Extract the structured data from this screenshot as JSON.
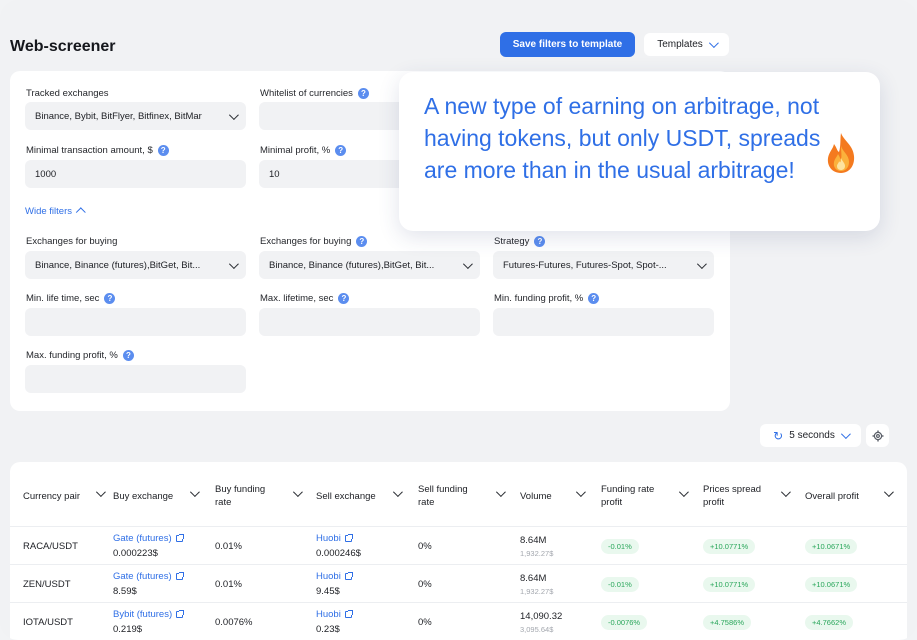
{
  "app": {
    "title": "Web-screener",
    "save_filters_label": "Save filters to template",
    "templates_label": "Templates"
  },
  "filters": {
    "tracked_exchanges": {
      "label": "Tracked exchanges",
      "value": "Binance, Bybit, BitFlyer, Bitfinex, BitMar"
    },
    "whitelist": {
      "label": "Whitelist of currencies",
      "value": ""
    },
    "min_transaction": {
      "label": "Minimal transaction amount, $",
      "value": "1000"
    },
    "min_profit": {
      "label": "Minimal profit, %",
      "value": "10"
    },
    "wide_filters_label": "Wide filters",
    "exchanges_buying_1": {
      "label": "Exchanges for buying",
      "value": "Binance, Binance (futures),BitGet, Bit..."
    },
    "exchanges_buying_2": {
      "label": "Exchanges for buying",
      "value": "Binance, Binance (futures),BitGet, Bit..."
    },
    "strategy": {
      "label": "Strategy",
      "value": "Futures-Futures, Futures-Spot, Spot-..."
    },
    "min_lifetime": {
      "label": "Min. life time, sec",
      "value": ""
    },
    "max_lifetime": {
      "label": "Max. lifetime, sec",
      "value": ""
    },
    "min_funding": {
      "label": "Min. funding profit, %",
      "value": ""
    },
    "max_funding": {
      "label": "Max. funding profit, %",
      "value": ""
    }
  },
  "tooltip": {
    "text": "A new type of earning on arbitrage, not having tokens, but only USDT, spreads are more than in the usual arbitrage!",
    "icon": "fire-icon"
  },
  "refresh": {
    "label": "5 seconds",
    "icon": "refresh-icon"
  },
  "table": {
    "headers": [
      "Currency pair",
      "Buy exchange",
      "Buy funding rate",
      "Sell exchange",
      "Sell funding rate",
      "Volume",
      "Funding rate profit",
      "Prices spread profit",
      "Overall profit"
    ],
    "rows": [
      {
        "pair": "RACA/USDT",
        "buy_exchange": "Gate (futures)",
        "buy_price": "0.000223$",
        "buy_funding": "0.01%",
        "sell_exchange": "Huobi",
        "sell_price": "0.000246$",
        "sell_funding": "0%",
        "volume": "8.64M",
        "volume_sub": "1,932.27$",
        "funding_profit": "-0.01%",
        "spread_profit": "+10.0771%",
        "overall_profit": "+10.0671%"
      },
      {
        "pair": "ZEN/USDT",
        "buy_exchange": "Gate (futures)",
        "buy_price": "8.59$",
        "buy_funding": "0.01%",
        "sell_exchange": "Huobi",
        "sell_price": "9.45$",
        "sell_funding": "0%",
        "volume": "8.64M",
        "volume_sub": "1,932.27$",
        "funding_profit": "-0.01%",
        "spread_profit": "+10.0771%",
        "overall_profit": "+10.0671%"
      },
      {
        "pair": "IOTA/USDT",
        "buy_exchange": "Bybit (futures)",
        "buy_price": "0.219$",
        "buy_funding": "0.0076%",
        "sell_exchange": "Huobi",
        "sell_price": "0.23$",
        "sell_funding": "0%",
        "volume": "14,090.32",
        "volume_sub": "3,095.64$",
        "funding_profit": "-0.0076%",
        "spread_profit": "+4.7586%",
        "overall_profit": "+4.7662%"
      }
    ]
  },
  "colors": {
    "accent": "#2f6fe6",
    "positive_bg": "#e9f8ee",
    "positive_text": "#29a65a"
  }
}
